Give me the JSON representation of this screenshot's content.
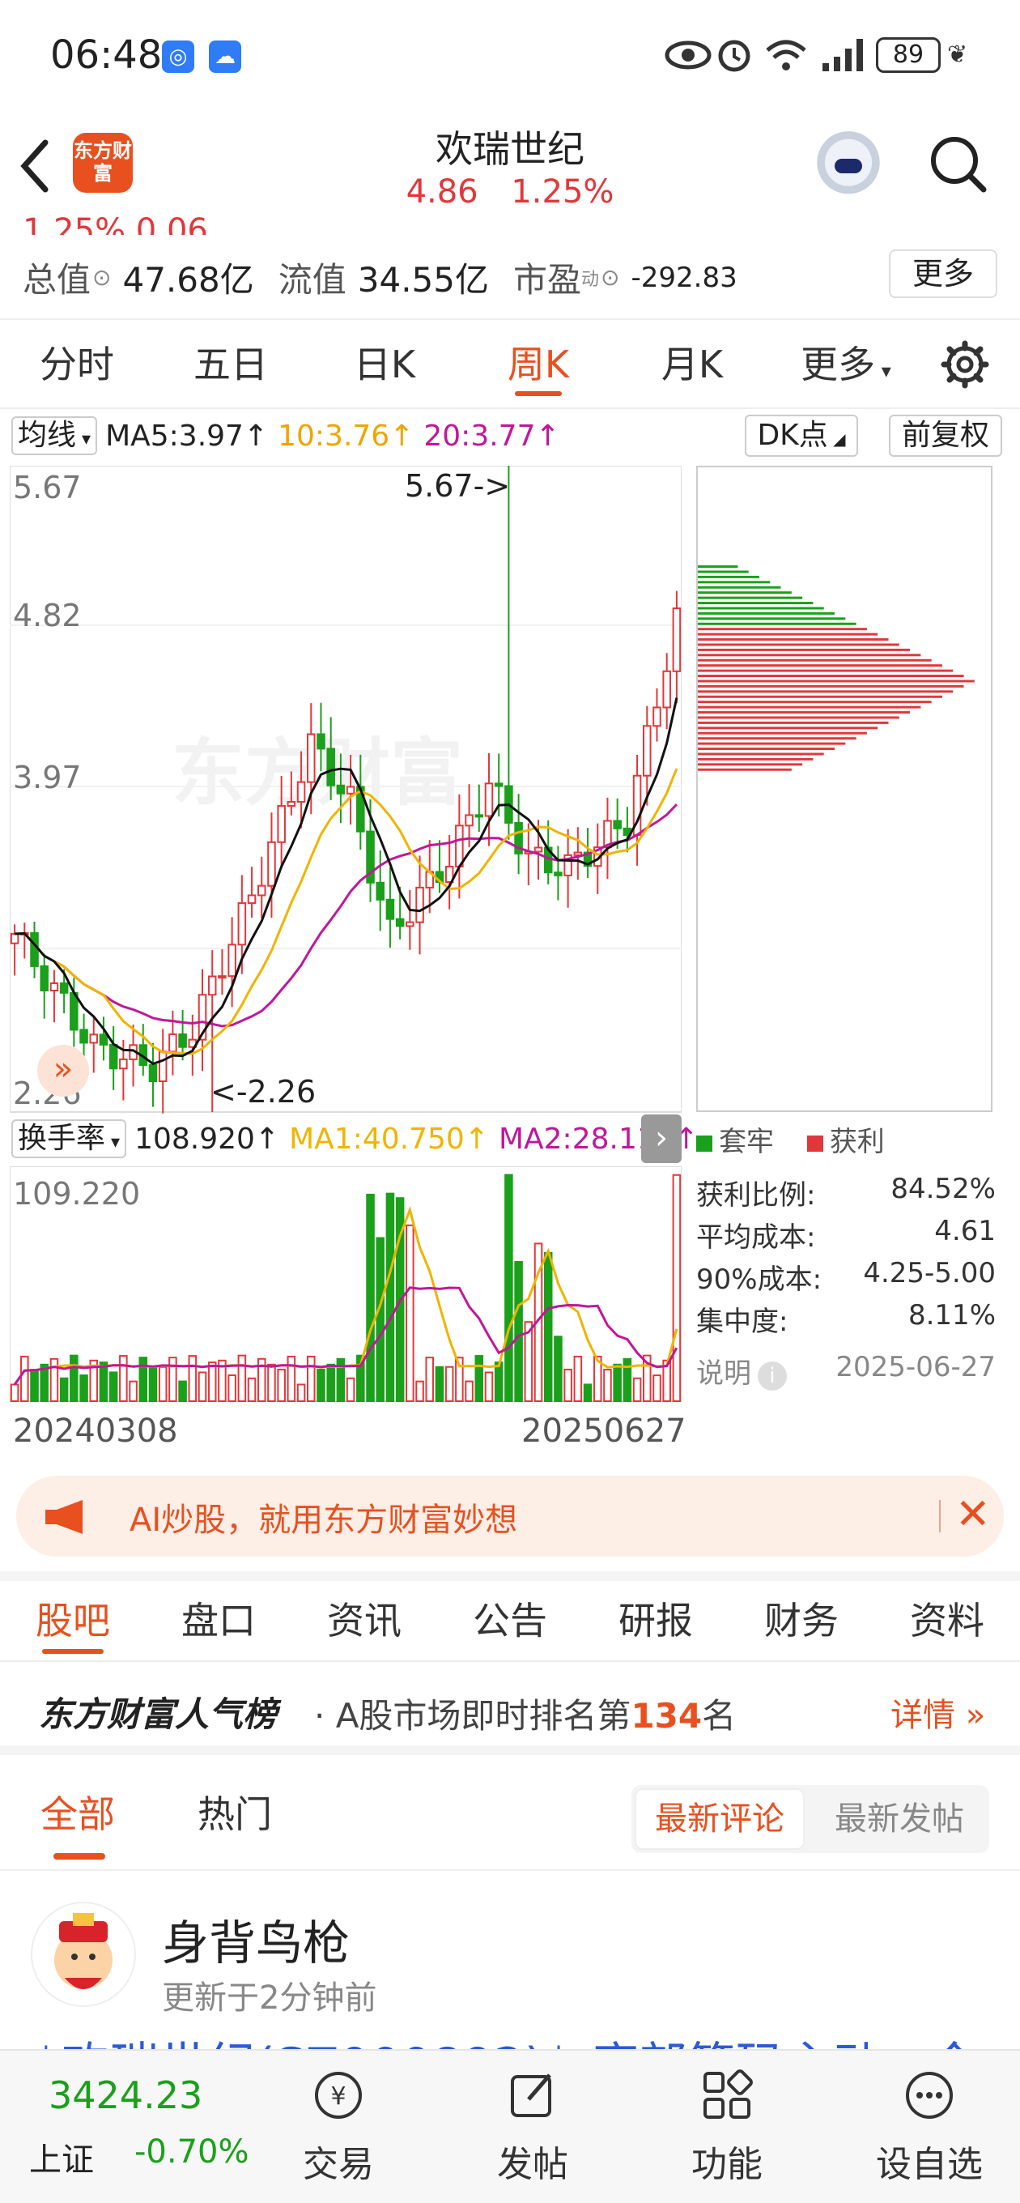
{
  "status_bar": {
    "time": "06:48",
    "battery": "89"
  },
  "header": {
    "back_icon": "chevron-left-icon",
    "logo_text": "东方财富",
    "title": "欢瑞世纪",
    "price": "4.86",
    "change_pct": "1.25%"
  },
  "stats": {
    "cut_row": "1.25%      0.06",
    "total_value_label": "总值",
    "total_value": "47.68亿",
    "float_value_label": "流值",
    "float_value": "34.55亿",
    "pe_label": "市盈",
    "pe_sup": "动",
    "pe_value": "-292.83",
    "more_label": "更多"
  },
  "kline_tabs": [
    "分时",
    "五日",
    "日K",
    "周K",
    "月K",
    "更多"
  ],
  "active_tab": "周K",
  "chart_legend": {
    "indicator": "均线",
    "ma5": "MA5:3.97↑",
    "ma10": "10:3.76↑",
    "ma20": "20:3.77↑",
    "dk": "DK点",
    "fq": "前复权"
  },
  "price_axis": {
    "top": "5.67",
    "mid1": "4.82",
    "mid2": "3.97",
    "bottom": "2.26"
  },
  "peak_label": "5.67->",
  "low_label": "<-2.26",
  "watermark": "东方财富",
  "volume_legend": {
    "indicator": "换手率",
    "value": "108.920↑",
    "ma1": "MA1:40.750↑",
    "ma2": "MA2:28.110↑",
    "axis_top": "109.220"
  },
  "dates": {
    "start": "20240308",
    "end": "20250627"
  },
  "chip_distribution": {
    "legend_trapped": "套牢",
    "legend_profit": "获利",
    "rows": [
      {
        "label": "获利比例:",
        "value": "84.52%"
      },
      {
        "label": "平均成本:",
        "value": "4.61"
      },
      {
        "label": "90%成本:",
        "value": "4.25-5.00"
      },
      {
        "label": "集中度:",
        "value": "8.11%"
      }
    ],
    "note_label": "说明",
    "note_date": "2025-06-27"
  },
  "chart_data": {
    "type": "candlestick",
    "period": "weekly",
    "ylim": [
      2.26,
      5.67
    ],
    "x_start": "20240308",
    "x_end": "20250627",
    "ma5": 3.97,
    "ma10": 3.76,
    "ma20": 3.77,
    "high": 5.67,
    "low": 2.26,
    "last_close": 4.86
  },
  "ai_banner": {
    "text": "AI炒股，就用东方财富妙想"
  },
  "sub_tabs": [
    "股吧",
    "盘口",
    "资讯",
    "公告",
    "研报",
    "财务",
    "资料"
  ],
  "rank": {
    "brand": "东方财富人气榜",
    "prefix": "· A股市场即时排名第",
    "number": "134",
    "suffix": "名",
    "more": "详情"
  },
  "filter": {
    "all": "全部",
    "hot": "热门",
    "latest_comment": "最新评论",
    "latest_post": "最新发帖"
  },
  "post": {
    "author": "身背鸟枪",
    "time": "更新于2分钟前",
    "cut_text": "$欢瑞世纪(SZ000892)$ 底部筹码主动，今"
  },
  "bottom_nav": {
    "index_value": "3424.23",
    "index_name": "上证",
    "index_change": "-0.70%",
    "items": [
      "交易",
      "发帖",
      "功能",
      "设自选"
    ]
  }
}
